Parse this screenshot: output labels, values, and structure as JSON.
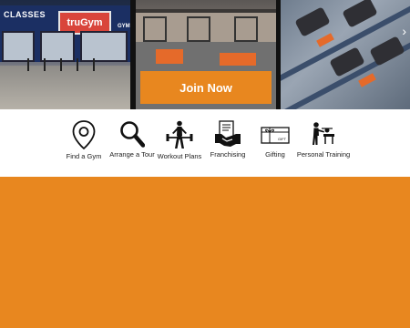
{
  "hero": {
    "storefront_classes": "CLASSES",
    "storefront_brand": "truGym",
    "storefront_gym": "GYM",
    "join_label": "Join Now",
    "next_arrow": "›"
  },
  "nav": {
    "items": [
      {
        "label": "Find a Gym",
        "icon": "location-pin-icon"
      },
      {
        "label": "Arrange a Tour",
        "icon": "magnifier-icon"
      },
      {
        "label": "Workout Plans",
        "icon": "weightlifter-icon"
      },
      {
        "label": "Franchising",
        "icon": "handshake-icon"
      },
      {
        "label": "Gifting",
        "icon": "gift-card-icon"
      },
      {
        "label": "Personal Training",
        "icon": "trainer-icon"
      }
    ],
    "gift_text": "GIFT"
  },
  "colors": {
    "accent": "#e8871f",
    "bar_bg": "#ffffff"
  }
}
